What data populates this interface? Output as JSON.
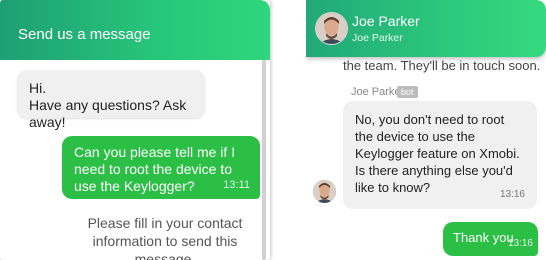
{
  "left": {
    "header_title": "Send us a message",
    "incoming_line1": "Hi.",
    "incoming_line2": "Have any questions? Ask away!",
    "outgoing_text": "Can you please tell me if I need to root the device to use the Keylogger?",
    "outgoing_time": "13:11",
    "footer_line1": "Please fill in your contact",
    "footer_line2": "information to send this message."
  },
  "right": {
    "header_name": "Joe Parker",
    "header_subtitle": "Joe Parker",
    "cut_text": "the team. They'll be in touch soon.",
    "bot_sender": "Joe Parker",
    "bot_badge": "bot",
    "bot_message": "No, you don't need to root the device to use the Keylogger feature on Xmobi. Is there anything else you'd like to know?",
    "bot_time": "13:16",
    "user_message": "Thank you",
    "user_time": "13:16"
  },
  "colors": {
    "header_green": "#27c77a",
    "bubble_green": "#2bbf45",
    "bubble_gray": "#f0f0f0"
  },
  "icons": {
    "agent_avatar": "person-avatar"
  }
}
